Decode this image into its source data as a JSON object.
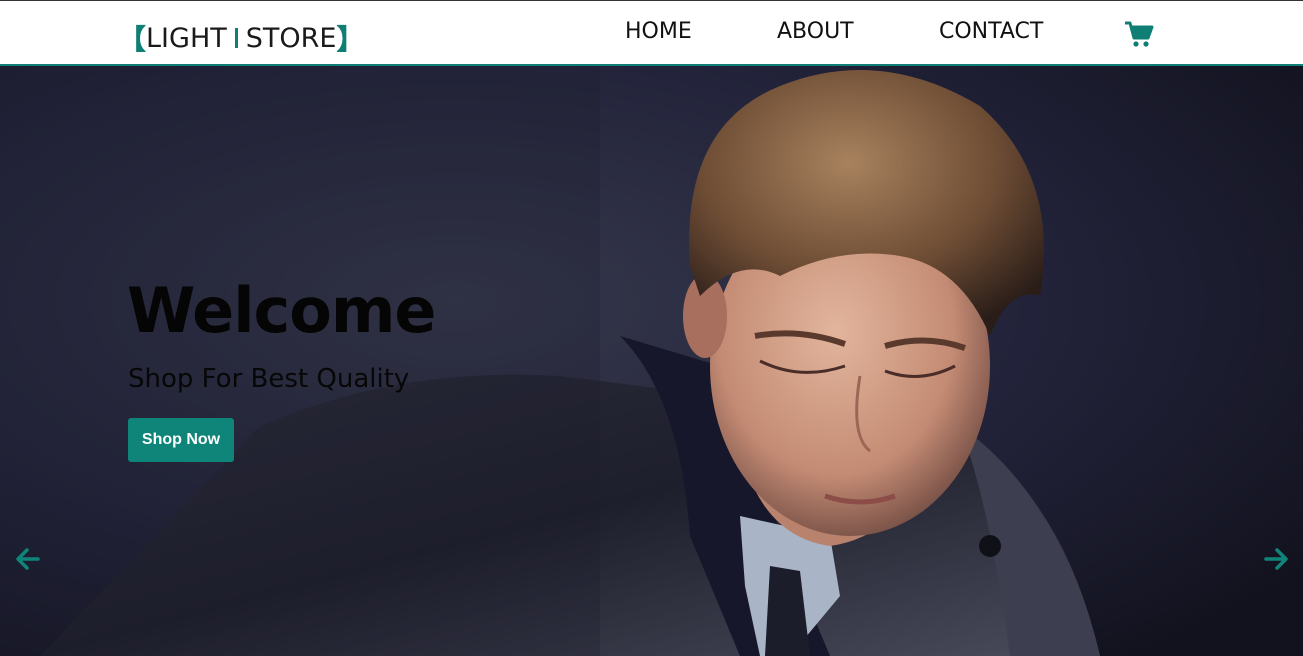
{
  "nav": {
    "logo_part1": "LIGHT",
    "logo_part2": "STORE",
    "links": [
      {
        "label": "HOME"
      },
      {
        "label": "ABOUT"
      },
      {
        "label": "CONTACT"
      }
    ],
    "cart_icon": "shopping-cart-icon"
  },
  "hero": {
    "title": "Welcome",
    "subtitle": "Shop For Best Quality",
    "button_label": "Shop Now",
    "prev_icon": "arrow-left-icon",
    "next_icon": "arrow-right-icon"
  },
  "colors": {
    "accent": "#0f857a",
    "nav_bg": "#ffffff",
    "hero_bg": "#252638"
  }
}
